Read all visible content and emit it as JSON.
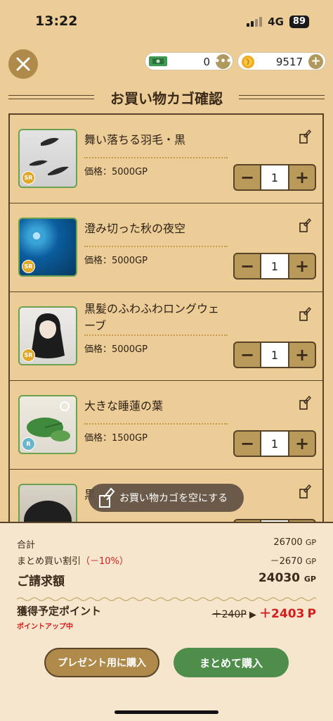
{
  "status_bar": {
    "time": "13:22",
    "network": "4G",
    "battery": "89"
  },
  "header": {
    "tickets_value": "0",
    "gp_value": "9517",
    "title": "お買い物カゴ確認"
  },
  "cart": {
    "items": [
      {
        "name": "舞い落ちる羽毛・黒",
        "price": "価格：5000GP",
        "quantity": "1",
        "rarity": "SR"
      },
      {
        "name": "澄み切った秋の夜空",
        "price": "価格：5000GP",
        "quantity": "1",
        "rarity": "SR"
      },
      {
        "name": "黒髪のふわふわロングウェーブ",
        "price": "価格：5000GP",
        "quantity": "1",
        "rarity": "SR"
      },
      {
        "name": "大きな睡蓮の葉",
        "price": "価格：1500GP",
        "quantity": "1",
        "rarity": "R"
      },
      {
        "name": "黒",
        "price": "",
        "quantity": "",
        "rarity": ""
      }
    ],
    "clear_label": "お買い物カゴを空にする"
  },
  "summary": {
    "total_label": "合計",
    "total_value": "26700",
    "discount_label": "まとめ買い割引",
    "discount_pct": "（－10%）",
    "discount_value": "－2670",
    "billing_label": "ご請求額",
    "billing_value": "24030",
    "unit_gp": "GP",
    "points_label": "獲得予定ポイント",
    "points_old": "＋240P",
    "points_new": "＋2403",
    "points_unit": "P",
    "points_note": "ポイントアップ中"
  },
  "actions": {
    "gift_label": "プレゼント用に購入",
    "buy_label": "まとめて購入"
  },
  "colors": {
    "background": "#eccd98",
    "accent_brown": "#b08a4a",
    "buy_green": "#4f8d4b",
    "discount_red": "#d61d1d"
  },
  "icons": [
    "close-icon",
    "ticket-icon",
    "gp-coin-icon",
    "more-icon",
    "plus-icon",
    "edit-icon",
    "trash-icon",
    "minus-icon"
  ]
}
